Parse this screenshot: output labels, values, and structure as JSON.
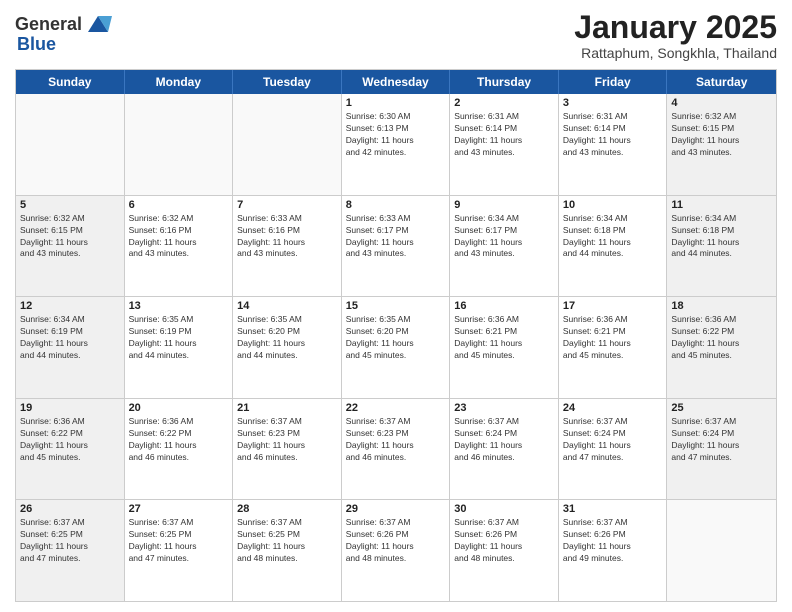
{
  "logo": {
    "general": "General",
    "blue": "Blue"
  },
  "header": {
    "month": "January 2025",
    "location": "Rattaphum, Songkhla, Thailand"
  },
  "days_of_week": [
    "Sunday",
    "Monday",
    "Tuesday",
    "Wednesday",
    "Thursday",
    "Friday",
    "Saturday"
  ],
  "weeks": [
    [
      {
        "day": "",
        "info": "",
        "empty": true
      },
      {
        "day": "",
        "info": "",
        "empty": true
      },
      {
        "day": "",
        "info": "",
        "empty": true
      },
      {
        "day": "1",
        "info": "Sunrise: 6:30 AM\nSunset: 6:13 PM\nDaylight: 11 hours\nand 42 minutes."
      },
      {
        "day": "2",
        "info": "Sunrise: 6:31 AM\nSunset: 6:14 PM\nDaylight: 11 hours\nand 43 minutes."
      },
      {
        "day": "3",
        "info": "Sunrise: 6:31 AM\nSunset: 6:14 PM\nDaylight: 11 hours\nand 43 minutes."
      },
      {
        "day": "4",
        "info": "Sunrise: 6:32 AM\nSunset: 6:15 PM\nDaylight: 11 hours\nand 43 minutes."
      }
    ],
    [
      {
        "day": "5",
        "info": "Sunrise: 6:32 AM\nSunset: 6:15 PM\nDaylight: 11 hours\nand 43 minutes."
      },
      {
        "day": "6",
        "info": "Sunrise: 6:32 AM\nSunset: 6:16 PM\nDaylight: 11 hours\nand 43 minutes."
      },
      {
        "day": "7",
        "info": "Sunrise: 6:33 AM\nSunset: 6:16 PM\nDaylight: 11 hours\nand 43 minutes."
      },
      {
        "day": "8",
        "info": "Sunrise: 6:33 AM\nSunset: 6:17 PM\nDaylight: 11 hours\nand 43 minutes."
      },
      {
        "day": "9",
        "info": "Sunrise: 6:34 AM\nSunset: 6:17 PM\nDaylight: 11 hours\nand 43 minutes."
      },
      {
        "day": "10",
        "info": "Sunrise: 6:34 AM\nSunset: 6:18 PM\nDaylight: 11 hours\nand 44 minutes."
      },
      {
        "day": "11",
        "info": "Sunrise: 6:34 AM\nSunset: 6:18 PM\nDaylight: 11 hours\nand 44 minutes."
      }
    ],
    [
      {
        "day": "12",
        "info": "Sunrise: 6:34 AM\nSunset: 6:19 PM\nDaylight: 11 hours\nand 44 minutes."
      },
      {
        "day": "13",
        "info": "Sunrise: 6:35 AM\nSunset: 6:19 PM\nDaylight: 11 hours\nand 44 minutes."
      },
      {
        "day": "14",
        "info": "Sunrise: 6:35 AM\nSunset: 6:20 PM\nDaylight: 11 hours\nand 44 minutes."
      },
      {
        "day": "15",
        "info": "Sunrise: 6:35 AM\nSunset: 6:20 PM\nDaylight: 11 hours\nand 45 minutes."
      },
      {
        "day": "16",
        "info": "Sunrise: 6:36 AM\nSunset: 6:21 PM\nDaylight: 11 hours\nand 45 minutes."
      },
      {
        "day": "17",
        "info": "Sunrise: 6:36 AM\nSunset: 6:21 PM\nDaylight: 11 hours\nand 45 minutes."
      },
      {
        "day": "18",
        "info": "Sunrise: 6:36 AM\nSunset: 6:22 PM\nDaylight: 11 hours\nand 45 minutes."
      }
    ],
    [
      {
        "day": "19",
        "info": "Sunrise: 6:36 AM\nSunset: 6:22 PM\nDaylight: 11 hours\nand 45 minutes."
      },
      {
        "day": "20",
        "info": "Sunrise: 6:36 AM\nSunset: 6:22 PM\nDaylight: 11 hours\nand 46 minutes."
      },
      {
        "day": "21",
        "info": "Sunrise: 6:37 AM\nSunset: 6:23 PM\nDaylight: 11 hours\nand 46 minutes."
      },
      {
        "day": "22",
        "info": "Sunrise: 6:37 AM\nSunset: 6:23 PM\nDaylight: 11 hours\nand 46 minutes."
      },
      {
        "day": "23",
        "info": "Sunrise: 6:37 AM\nSunset: 6:24 PM\nDaylight: 11 hours\nand 46 minutes."
      },
      {
        "day": "24",
        "info": "Sunrise: 6:37 AM\nSunset: 6:24 PM\nDaylight: 11 hours\nand 47 minutes."
      },
      {
        "day": "25",
        "info": "Sunrise: 6:37 AM\nSunset: 6:24 PM\nDaylight: 11 hours\nand 47 minutes."
      }
    ],
    [
      {
        "day": "26",
        "info": "Sunrise: 6:37 AM\nSunset: 6:25 PM\nDaylight: 11 hours\nand 47 minutes."
      },
      {
        "day": "27",
        "info": "Sunrise: 6:37 AM\nSunset: 6:25 PM\nDaylight: 11 hours\nand 47 minutes."
      },
      {
        "day": "28",
        "info": "Sunrise: 6:37 AM\nSunset: 6:25 PM\nDaylight: 11 hours\nand 48 minutes."
      },
      {
        "day": "29",
        "info": "Sunrise: 6:37 AM\nSunset: 6:26 PM\nDaylight: 11 hours\nand 48 minutes."
      },
      {
        "day": "30",
        "info": "Sunrise: 6:37 AM\nSunset: 6:26 PM\nDaylight: 11 hours\nand 48 minutes."
      },
      {
        "day": "31",
        "info": "Sunrise: 6:37 AM\nSunset: 6:26 PM\nDaylight: 11 hours\nand 49 minutes."
      },
      {
        "day": "",
        "info": "",
        "empty": true
      }
    ]
  ]
}
